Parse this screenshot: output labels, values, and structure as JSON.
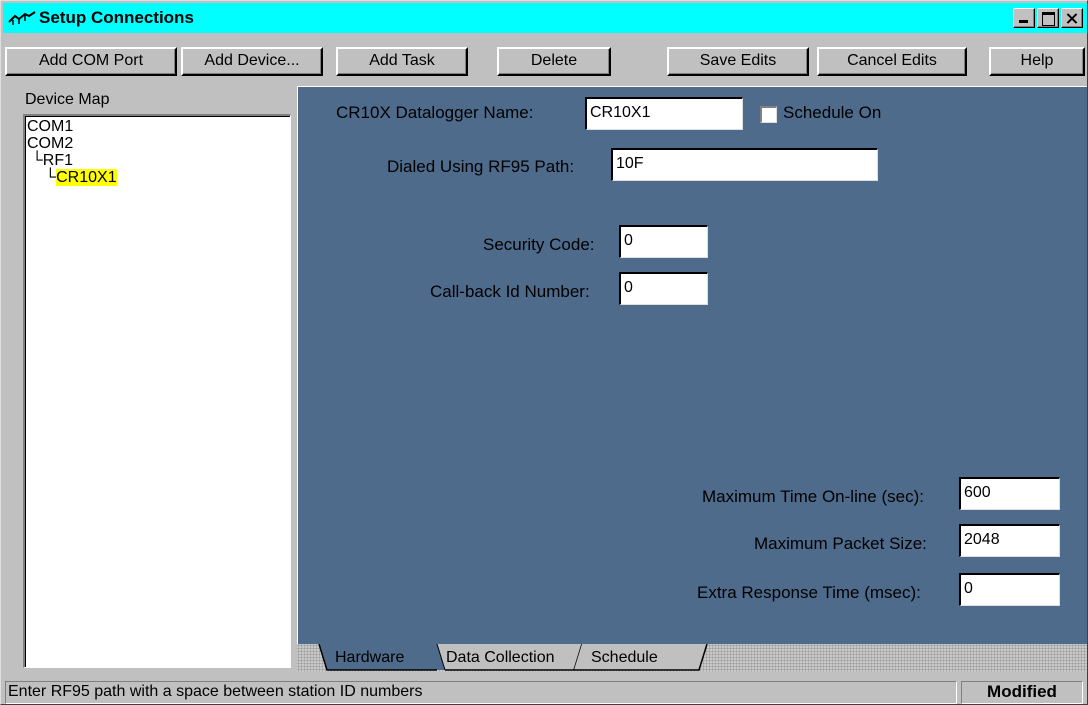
{
  "window": {
    "title": "Setup Connections",
    "title_bar_color": "#00ffff"
  },
  "toolbar": {
    "add_com_port": "Add COM Port",
    "add_device": "Add Device...",
    "add_task": "Add Task",
    "delete": "Delete",
    "save_edits": "Save Edits",
    "cancel_edits": "Cancel Edits",
    "help": "Help"
  },
  "device_map": {
    "label": "Device Map",
    "items": [
      {
        "text": "COM1",
        "prefix": ""
      },
      {
        "text": "COM2",
        "prefix": ""
      },
      {
        "text": "RF1",
        "prefix": " └"
      },
      {
        "text": "CR10X1",
        "prefix": "    └",
        "selected": true
      }
    ],
    "selected_highlight": "#ffff00"
  },
  "form": {
    "panel_color": "#4f6b8b",
    "datalogger_name_label": "CR10X Datalogger Name:",
    "datalogger_name_value": "CR10X1",
    "schedule_on_label": "Schedule On",
    "dialed_path_label": "Dialed Using RF95  Path:",
    "dialed_path_value": "10F",
    "security_code_label": "Security Code:",
    "security_code_value": "0",
    "callback_id_label": "Call-back Id Number:",
    "callback_id_value": "0",
    "max_time_label": "Maximum Time On-line (sec):",
    "max_time_value": "600",
    "max_packet_label": "Maximum Packet Size:",
    "max_packet_value": "2048",
    "extra_response_label": "Extra Response Time (msec):",
    "extra_response_value": "0"
  },
  "tabs": {
    "hardware": "Hardware",
    "data_collection": "Data Collection",
    "schedule": "Schedule"
  },
  "status": {
    "message": "Enter RF95 path with a space between station ID numbers",
    "badge": "Modified"
  }
}
